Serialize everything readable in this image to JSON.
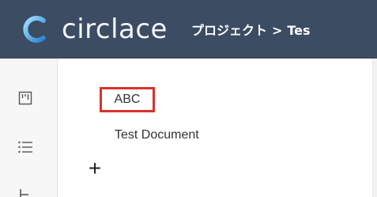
{
  "header": {
    "logo_text": "circlace",
    "breadcrumb": {
      "project": "プロジェクト",
      "separator": ">",
      "current": "Tes"
    }
  },
  "sidebar": {
    "icons": [
      "board-icon",
      "list-icon",
      "tree-icon"
    ]
  },
  "main": {
    "items": [
      {
        "label": "ABC",
        "highlighted": true
      },
      {
        "label": "Test Document"
      }
    ],
    "add_label": "+"
  },
  "colors": {
    "header_bg": "#3b4c63",
    "highlight_border": "#d9312b",
    "sidebar_bg": "#f7f7f7"
  }
}
